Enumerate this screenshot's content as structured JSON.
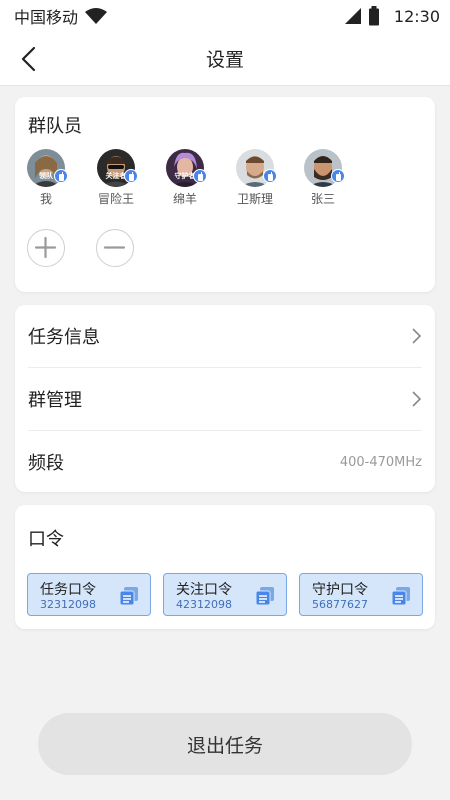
{
  "status_bar": {
    "carrier": "中国移动",
    "time": "12:30"
  },
  "nav": {
    "title": "设置"
  },
  "members": {
    "title": "群队员",
    "list": [
      {
        "name": "我",
        "tag": "领队"
      },
      {
        "name": "冒险王",
        "tag": "关注者"
      },
      {
        "name": "绵羊",
        "tag": "守护者"
      },
      {
        "name": "卫斯理",
        "tag": ""
      },
      {
        "name": "张三",
        "tag": ""
      }
    ]
  },
  "menu": {
    "task_info": "任务信息",
    "group_manage": "群管理",
    "band_label": "频段",
    "band_value": "400-470MHz"
  },
  "passwords": {
    "title": "口令",
    "items": [
      {
        "label": "任务口令",
        "code": "32312098"
      },
      {
        "label": "关注口令",
        "code": "42312098"
      },
      {
        "label": "守护口令",
        "code": "56877627"
      }
    ]
  },
  "exit_button": "退出任务",
  "colors": {
    "accent": "#4a86e8",
    "chip_bg": "#d5e6fb",
    "chip_border": "#7aa7e6"
  }
}
